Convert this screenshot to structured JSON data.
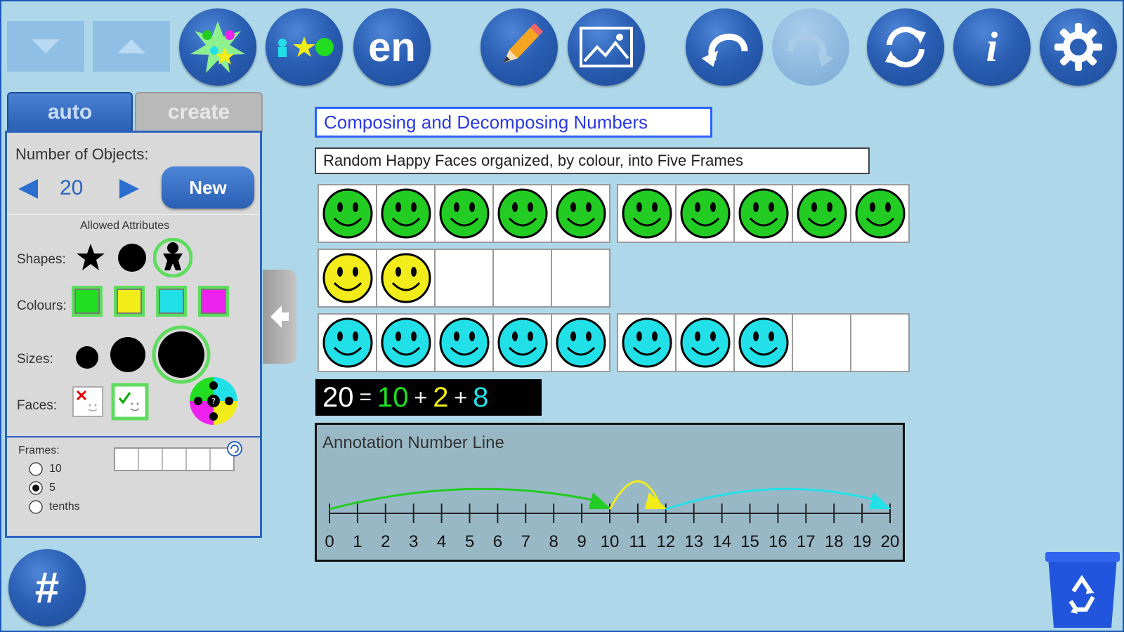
{
  "toolbar": {
    "lang_label": "en",
    "info_label": "i",
    "hash_label": "#"
  },
  "tabs": {
    "auto": "auto",
    "create": "create"
  },
  "panel": {
    "number_of_objects_label": "Number of Objects:",
    "count_value": "20",
    "new_button_label": "New",
    "allowed_attributes_label": "Allowed Attributes",
    "shapes_label": "Shapes:",
    "colours_label": "Colours:",
    "sizes_label": "Sizes:",
    "faces_label": "Faces:",
    "frames_label": "Frames:",
    "frame_options": [
      "10",
      "5",
      "tenths"
    ],
    "selected_frame_option": "5"
  },
  "colors": {
    "green": "#22cc22",
    "yellow": "#f2ec1a",
    "cyan": "#22e0e8",
    "magenta": "#ee22ee",
    "accent": "#2a5fb4"
  },
  "workspace": {
    "title": "Composing and Decomposing Numbers",
    "description": "Random Happy Faces organized, by colour, into Five Frames",
    "equation": {
      "total": "20",
      "eq": "=",
      "part1": "10",
      "plus1": "+",
      "part2": "2",
      "plus2": "+",
      "part3": "8"
    },
    "frames": [
      {
        "color": "green",
        "filled": 10,
        "cells": 10
      },
      {
        "color": "yellow",
        "filled": 2,
        "cells": 5
      },
      {
        "color": "cyan",
        "filled": 8,
        "cells": 10
      }
    ],
    "number_line": {
      "title": "Annotation Number Line",
      "min": 0,
      "max": 20,
      "ticks": [
        "0",
        "1",
        "2",
        "3",
        "4",
        "5",
        "6",
        "7",
        "8",
        "9",
        "10",
        "11",
        "12",
        "13",
        "14",
        "15",
        "16",
        "17",
        "18",
        "19",
        "20"
      ],
      "jumps": [
        {
          "from": 0,
          "to": 10,
          "color": "green"
        },
        {
          "from": 10,
          "to": 12,
          "color": "yellow"
        },
        {
          "from": 12,
          "to": 20,
          "color": "cyan"
        }
      ]
    }
  }
}
